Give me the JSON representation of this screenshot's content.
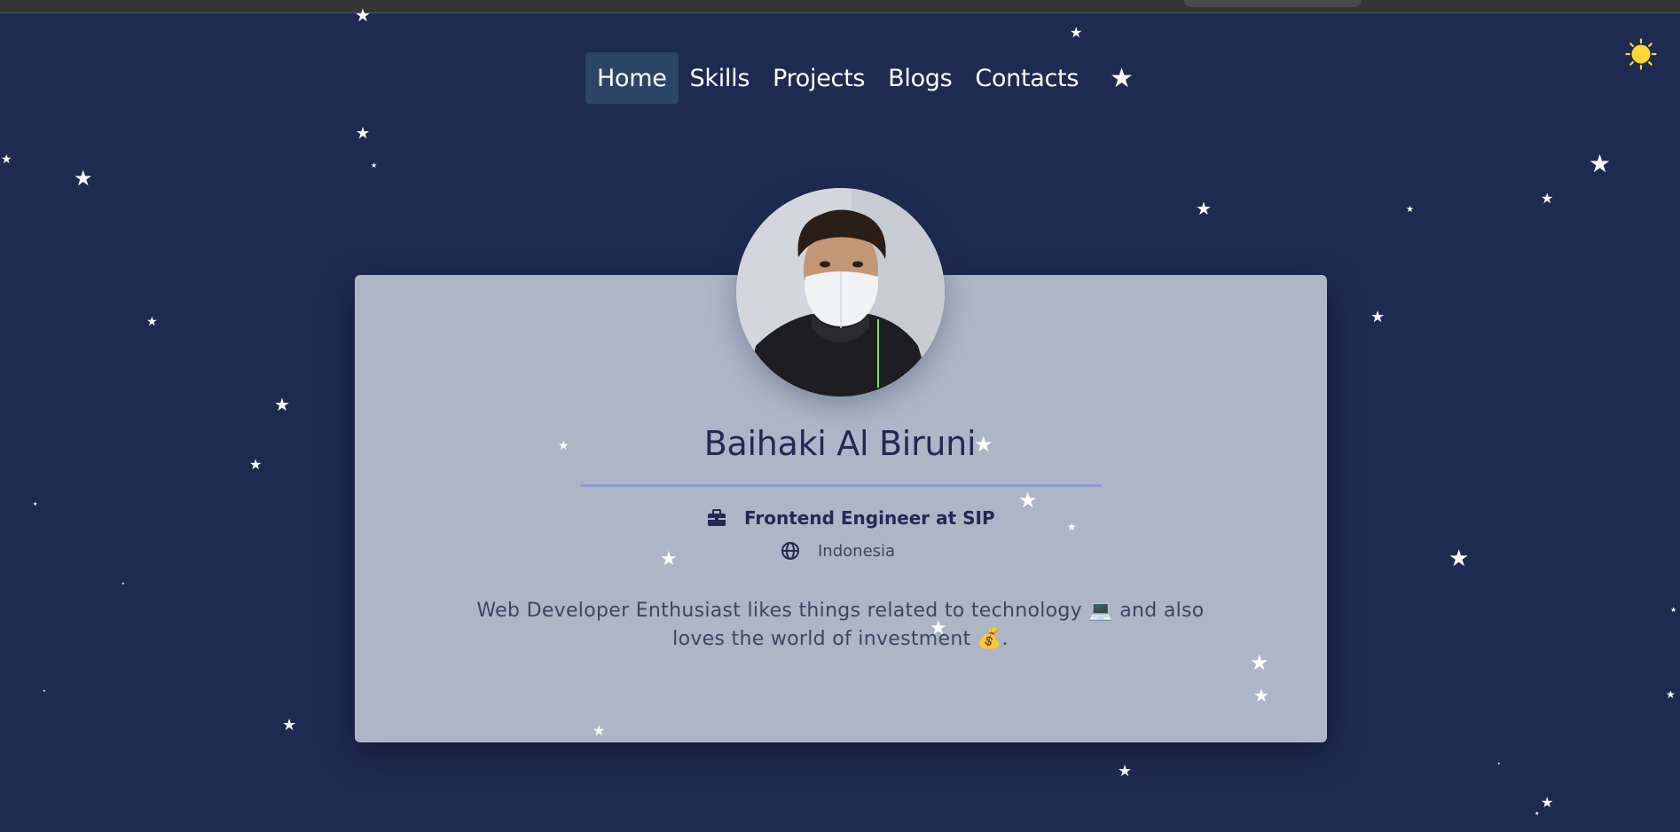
{
  "nav": {
    "items": [
      {
        "label": "Home",
        "active": true
      },
      {
        "label": "Skills",
        "active": false
      },
      {
        "label": "Projects",
        "active": false
      },
      {
        "label": "Blogs",
        "active": false
      },
      {
        "label": "Contacts",
        "active": false
      }
    ],
    "star_toggle_icon": "star-icon"
  },
  "theme_toggle_icon": "sun-icon",
  "profile": {
    "name": "Baihaki Al Biruni",
    "job": "Frontend Engineer at SIP",
    "location": "Indonesia",
    "bio_line1": "Web Developer Enthusiast likes things related to technology 💻 and also",
    "bio_line2": "loves the world of investment 💰."
  },
  "colors": {
    "background": "#1e2b50",
    "card": "#adb6c6",
    "text_dark": "#1f2b52",
    "accent_line": "#8c9bcf",
    "sun": "#fdd835",
    "nav_active": "#2c4466"
  }
}
